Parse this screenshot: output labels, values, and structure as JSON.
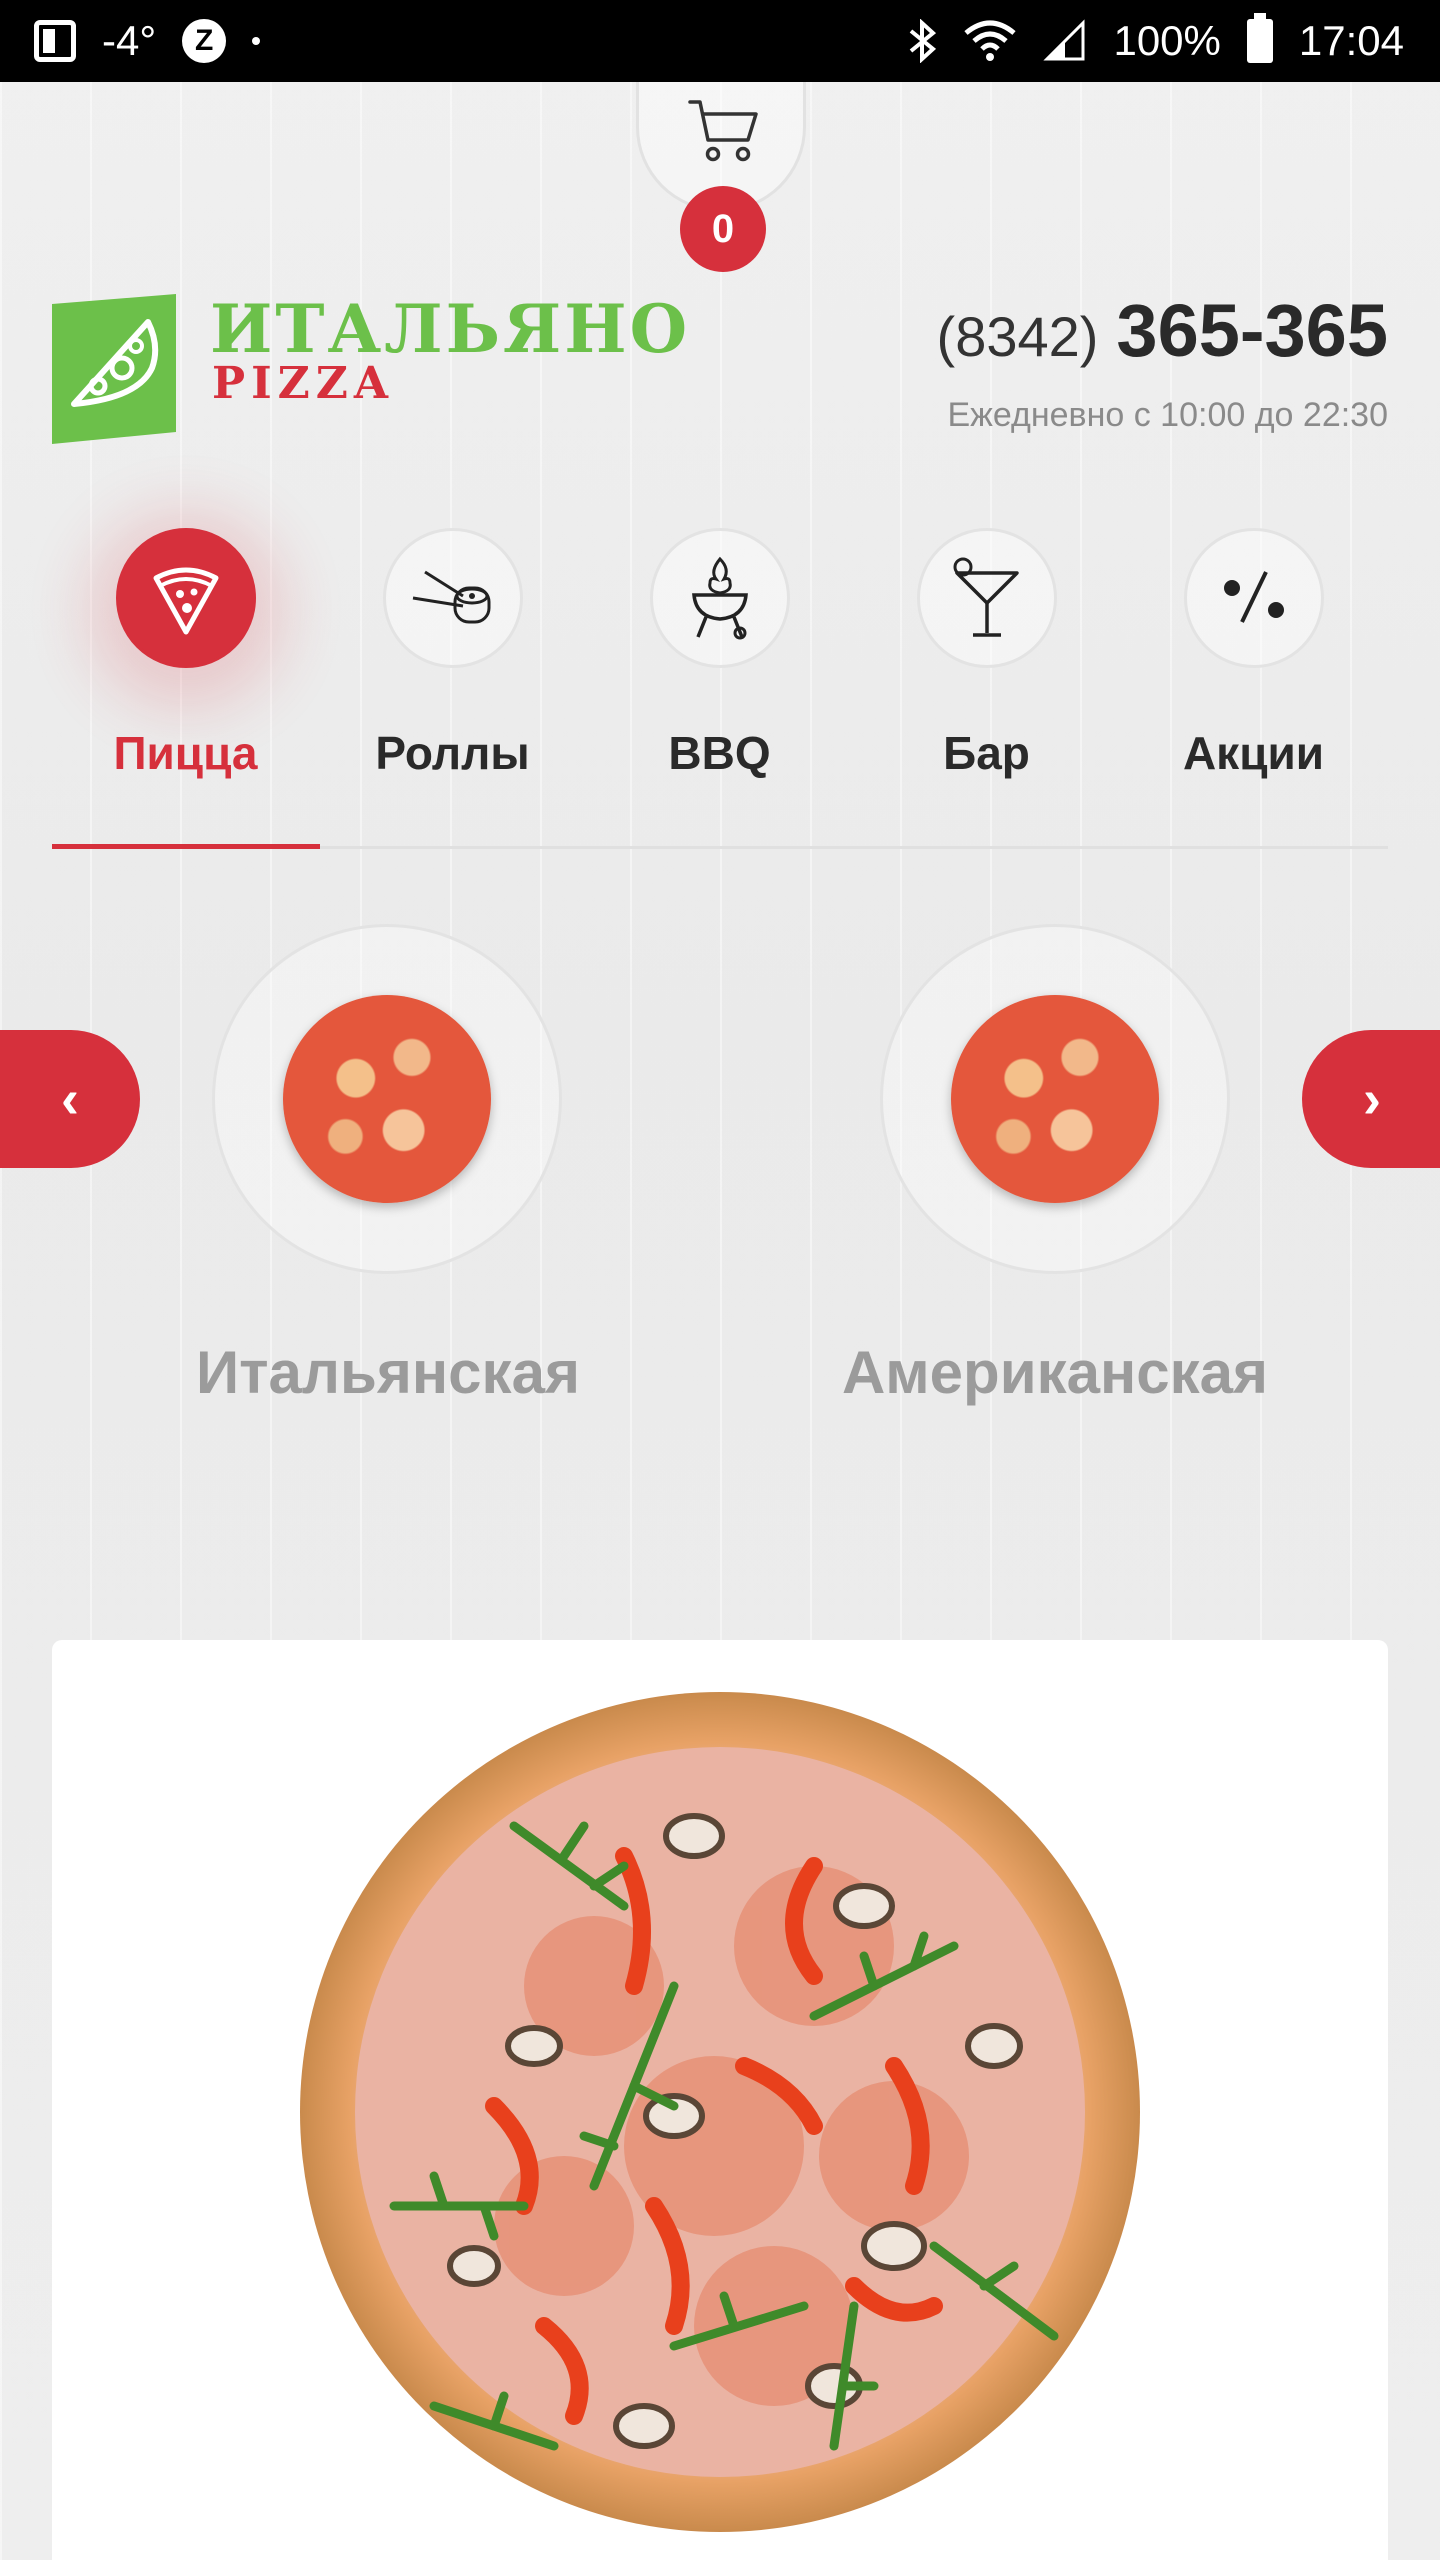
{
  "status_bar": {
    "temperature": "-4°",
    "z_badge": "Z",
    "battery": "100%",
    "time": "17:04"
  },
  "cart": {
    "count": "0"
  },
  "header": {
    "logo_title": "ИТАЛЬЯНО",
    "logo_subtitle": "PIZZA",
    "phone_code": "(8342)",
    "phone_number": "365-365",
    "hours": "Ежедневно с 10:00 до 22:30"
  },
  "categories": [
    {
      "label": "Пицца",
      "icon": "pizza-slice-icon",
      "active": true
    },
    {
      "label": "Роллы",
      "icon": "sushi-roll-icon",
      "active": false
    },
    {
      "label": "BBQ",
      "icon": "grill-icon",
      "active": false
    },
    {
      "label": "Бар",
      "icon": "cocktail-icon",
      "active": false
    },
    {
      "label": "Акции",
      "icon": "percent-icon",
      "active": false
    }
  ],
  "subcategories": [
    {
      "label": "Итальянская"
    },
    {
      "label": "Американская"
    }
  ],
  "carousel": {
    "prev": "‹",
    "next": "›"
  },
  "colors": {
    "accent": "#d6303c",
    "logo_green": "#6cc04a",
    "text_dark": "#2a2a2a",
    "text_muted": "#9b9b9b"
  }
}
